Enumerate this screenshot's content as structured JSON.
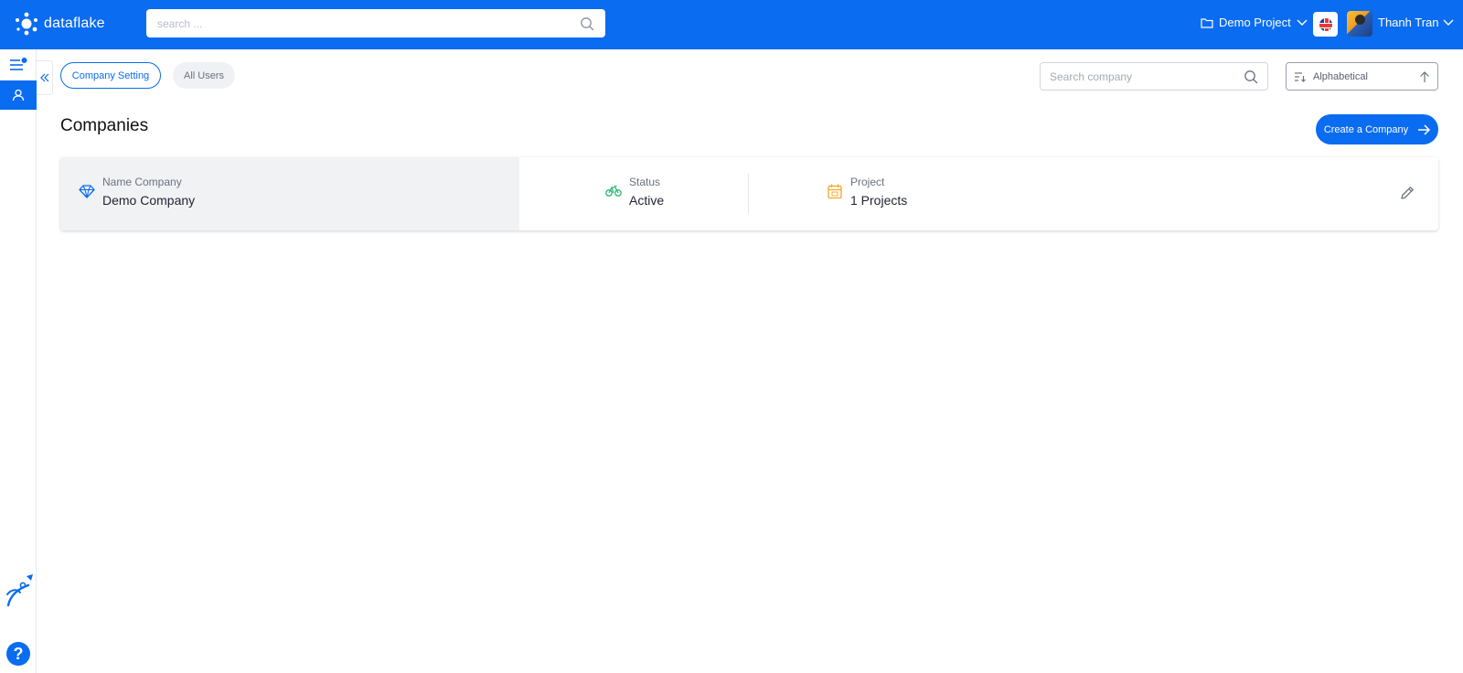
{
  "brand": {
    "name": "dataflake",
    "color": "#0a6cf0"
  },
  "header": {
    "search_placeholder": "search ...",
    "project_label": "Demo Project",
    "user_name": "Thanh Tran"
  },
  "rail": {
    "help_label": "?"
  },
  "tabs": [
    {
      "label": "Company Setting",
      "active": true
    },
    {
      "label": "All Users",
      "active": false
    }
  ],
  "toolbar": {
    "company_search_placeholder": "Search company",
    "sort_label": "Alphabetical"
  },
  "page": {
    "title": "Companies",
    "create_label": "Create a Company"
  },
  "companies": [
    {
      "name_label": "Name Company",
      "name": "Demo Company",
      "status_label": "Status",
      "status": "Active",
      "project_label": "Project",
      "projects": "1 Projects"
    }
  ],
  "icons": {
    "logo": "molecule-logo-icon",
    "search": "search-icon",
    "folder": "folder-icon",
    "chevron": "chevron-down-icon",
    "flag": "uk-flag-icon",
    "menu": "menu-icon",
    "user": "user-icon",
    "collapse": "double-chevron-left-icon",
    "rocket": "rocket-icon",
    "help": "help-icon",
    "sort": "sort-icon",
    "arrow_up": "arrow-up-icon",
    "arrow_right": "arrow-right-icon",
    "diamond": "diamond-icon",
    "bicycle": "bicycle-icon",
    "calendar": "calendar-icon",
    "edit": "pencil-icon"
  }
}
